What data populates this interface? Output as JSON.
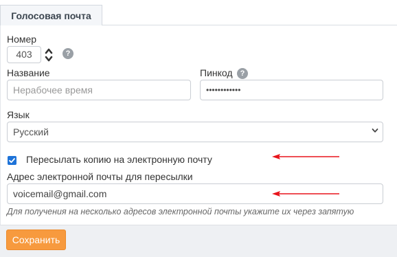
{
  "tab": {
    "label": "Голосовая почта"
  },
  "form": {
    "number": {
      "label": "Номер",
      "value": "403"
    },
    "name": {
      "label": "Название",
      "placeholder": "Нерабочее время"
    },
    "pin": {
      "label": "Пинкод",
      "value": "••••••••••••"
    },
    "language": {
      "label": "Язык",
      "selected": "Русский"
    },
    "forward": {
      "label": "Пересылать копию на электронную почту",
      "checked": true
    },
    "email": {
      "label": "Адрес электронной почты для пересылки",
      "value": "voicemail@gmail.com"
    },
    "hint": "Для получения на несколько адресов электронной почты укажите их через запятую",
    "help_glyph": "?"
  },
  "footer": {
    "save_label": "Сохранить"
  },
  "colors": {
    "accent": "#f79a3e",
    "checkbox": "#1e73d8",
    "arrow": "#e8141b"
  }
}
